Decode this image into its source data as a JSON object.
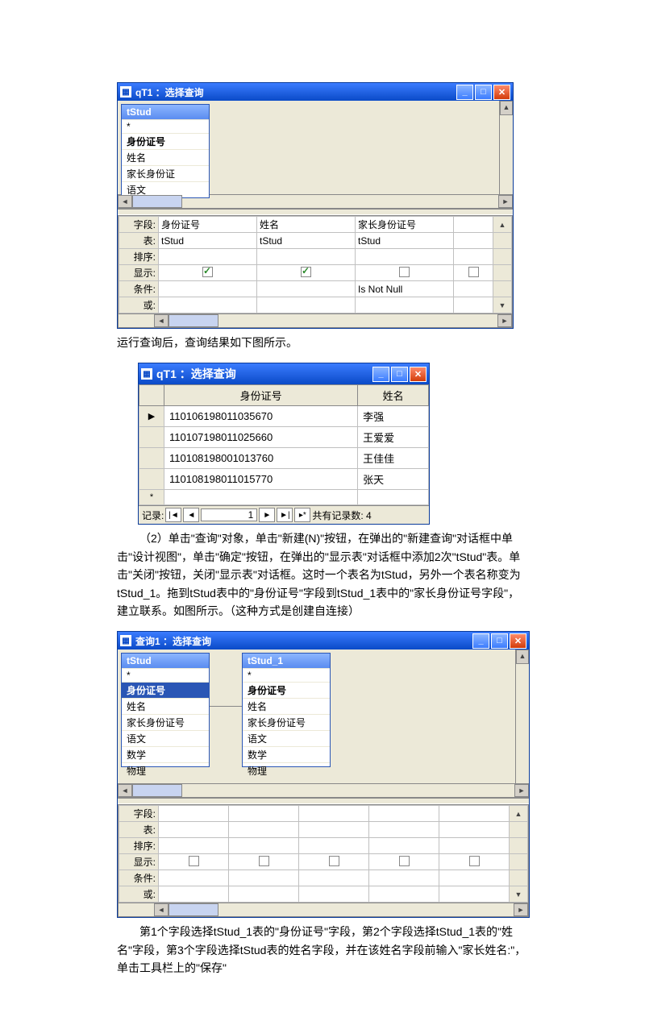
{
  "win1": {
    "title": "qT1 ：选择查询",
    "tbox": {
      "name": "tStud",
      "rows": [
        "*",
        "身份证号",
        "姓名",
        "家长身份证",
        "语文"
      ]
    },
    "rows": [
      "字段:",
      "表:",
      "排序:",
      "显示:",
      "条件:",
      "或:"
    ],
    "c1": {
      "f": "身份证号",
      "t": "tStud"
    },
    "c2": {
      "f": "姓名",
      "t": "tStud"
    },
    "c3": {
      "f": "家长身份证号",
      "t": "tStud",
      "cond": "Is Not Null"
    }
  },
  "txt1": "运行查询后，查询结果如下图所示。",
  "win2": {
    "title": "qT1 ：选择查询",
    "h1": "身份证号",
    "h2": "姓名",
    "r": [
      [
        "110106198011035670",
        "李强"
      ],
      [
        "110107198011025660",
        "王爱爱"
      ],
      [
        "110108198001013760",
        "王佳佳"
      ],
      [
        "110108198011015770",
        "张天"
      ]
    ],
    "rec": "记录:",
    "rv": "1",
    "rc": "共有记录数: 4"
  },
  "txt2": "（2）单击\"查询\"对象，单击\"新建(N)\"按钮，在弹出的\"新建查询\"对话框中单击\"设计视图\"，单击\"确定\"按钮，在弹出的\"显示表\"对话框中添加2次\"tStud\"表。单击\"关闭\"按钮，关闭\"显示表\"对话框。这时一个表名为tStud，另外一个表名称变为tStud_1。拖到tStud表中的\"身份证号\"字段到tStud_1表中的\"家长身份证号字段\"，建立联系。如图所示。（这种方式是创建自连接）",
  "win3": {
    "title": "查询1 ：选择查询",
    "t1": {
      "name": "tStud",
      "rows": [
        "*",
        "身份证号",
        "姓名",
        "家长身份证号",
        "语文",
        "数学",
        "物理"
      ]
    },
    "t2": {
      "name": "tStud_1",
      "rows": [
        "*",
        "身份证号",
        "姓名",
        "家长身份证号",
        "语文",
        "数学",
        "物理"
      ]
    },
    "rows": [
      "字段:",
      "表:",
      "排序:",
      "显示:",
      "条件:",
      "或:"
    ]
  },
  "txt3": "第1个字段选择tStud_1表的\"身份证号\"字段，第2个字段选择tStud_1表的\"姓名\"字段，第3个字段选择tStud表的姓名字段，并在该姓名字段前输入\"家长姓名:\"，单击工具栏上的\"保存\""
}
